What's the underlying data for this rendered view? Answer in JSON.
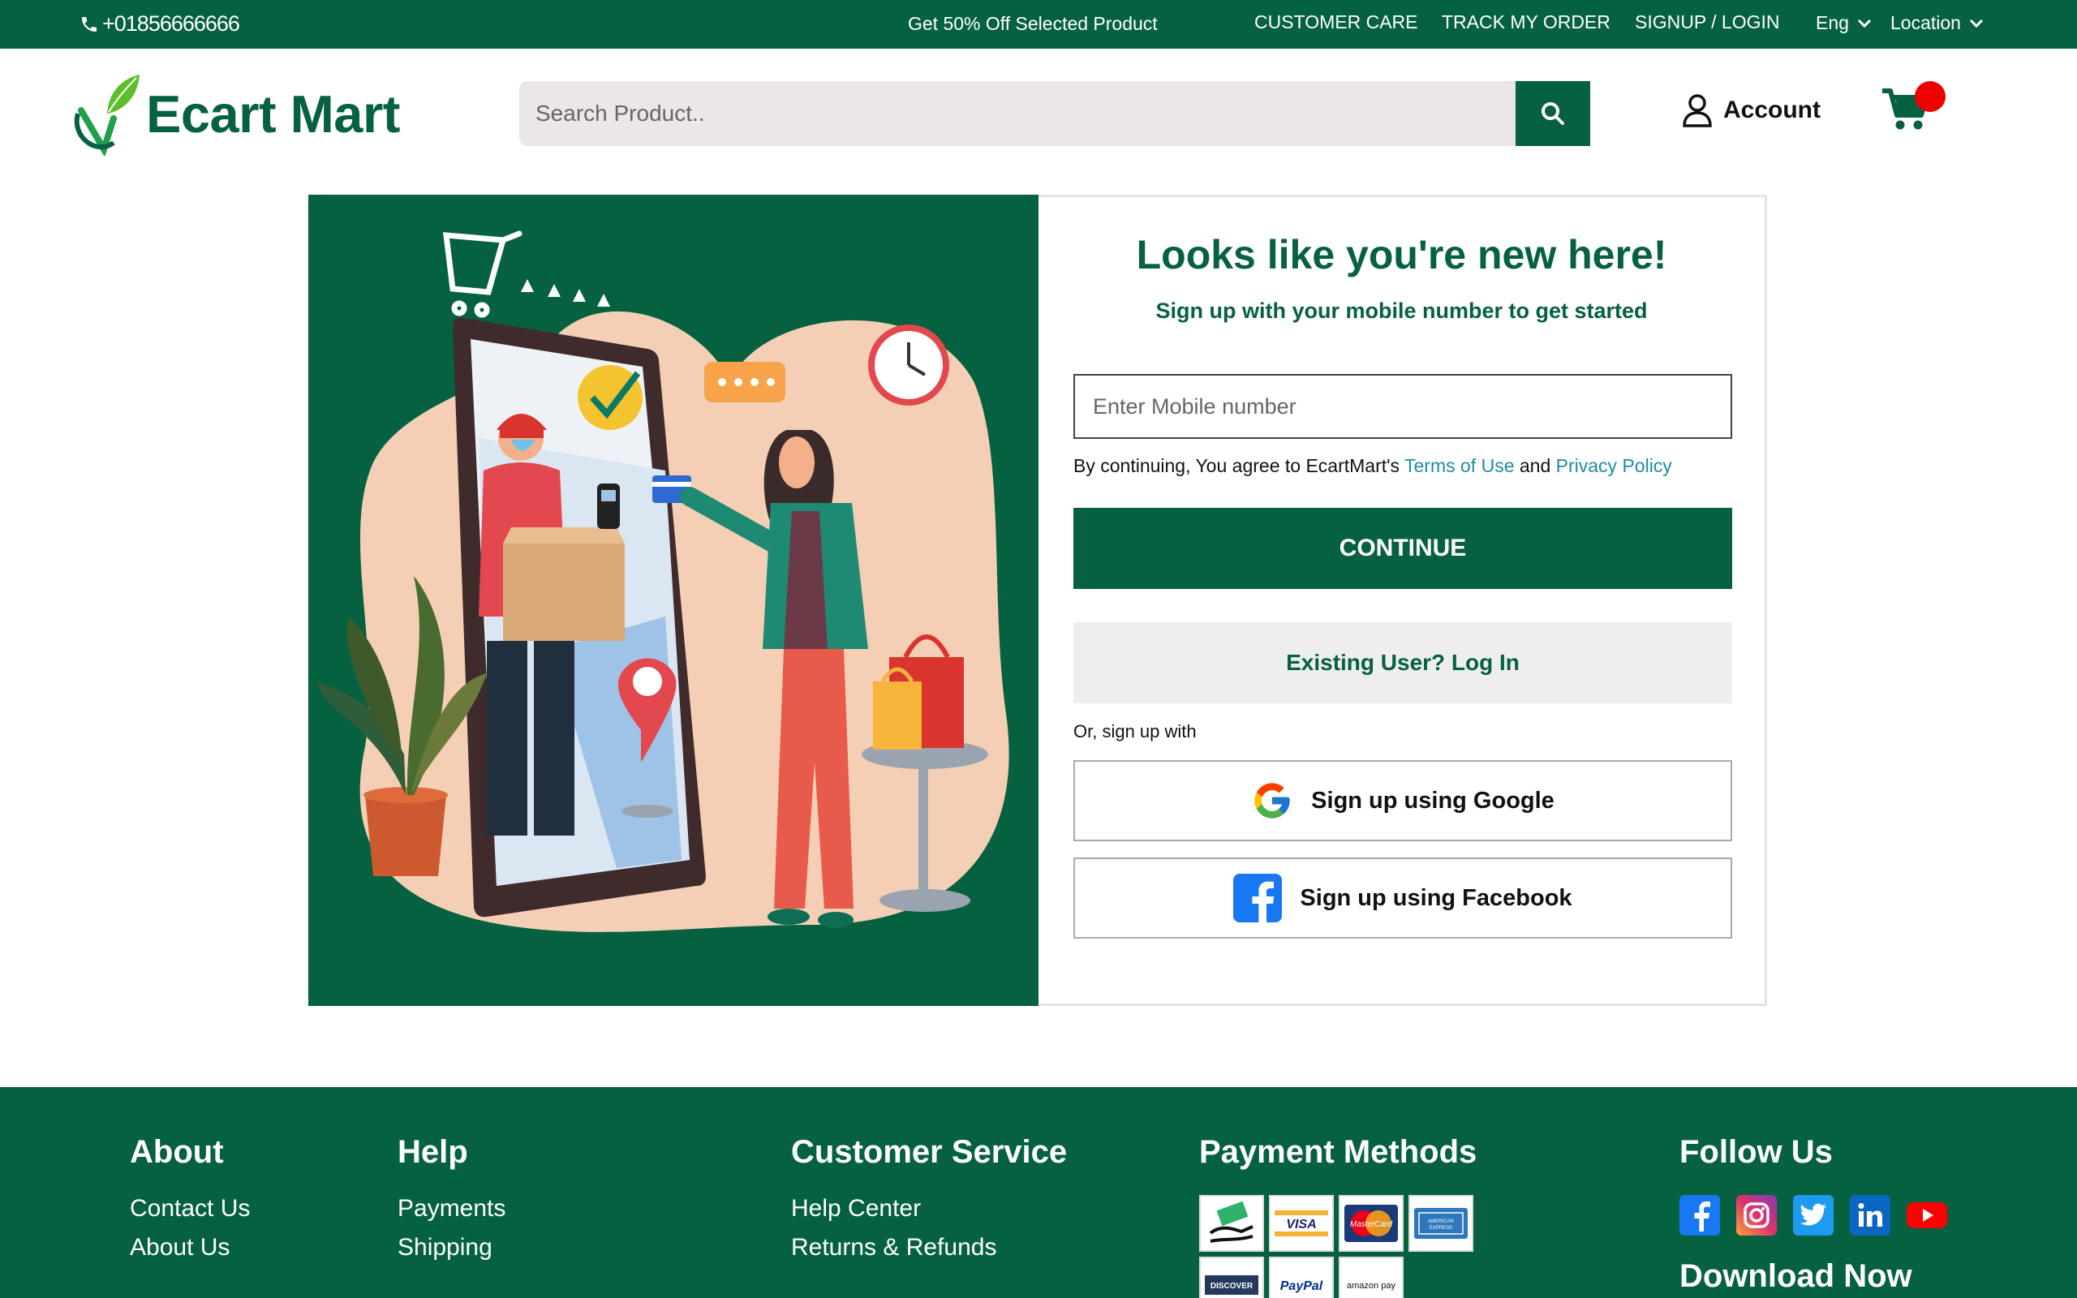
{
  "topbar": {
    "phone": "+01856666666",
    "promo": "Get 50% Off Selected Product",
    "links": [
      "CUSTOMER CARE",
      "TRACK MY ORDER",
      "SIGNUP / LOGIN"
    ],
    "language": "Eng",
    "location": "Location"
  },
  "header": {
    "brand": "Ecart Mart",
    "search_placeholder": "Search Product..",
    "account_label": "Account"
  },
  "signup": {
    "title": "Looks like you're new here!",
    "subtitle": "Sign up with your mobile number to get started",
    "mobile_placeholder": "Enter Mobile number",
    "terms_prefix": "By continuing, You agree to EcartMart's",
    "terms_link": "Terms of Use",
    "terms_and": "and",
    "privacy_link": "Privacy Policy",
    "continue_label": "CONTINUE",
    "login_label": "Existing User? Log In",
    "or_label": "Or, sign up with",
    "google_label": "Sign up using Google",
    "facebook_label": "Sign up using Facebook"
  },
  "footer": {
    "about": {
      "title": "About",
      "links": [
        "Contact Us",
        "About Us"
      ]
    },
    "help": {
      "title": "Help",
      "links": [
        "Payments",
        "Shipping"
      ]
    },
    "customer_service": {
      "title": "Customer Service",
      "links": [
        "Help Center",
        "Returns & Refunds"
      ]
    },
    "payment": {
      "title": "Payment Methods",
      "methods": [
        "cash-on-delivery-icon",
        "VISA",
        "MasterCard",
        "American Express",
        "DISCOVER",
        "PayPal",
        "amazon pay"
      ]
    },
    "follow": {
      "title": "Follow Us",
      "networks": [
        "facebook-icon",
        "instagram-icon",
        "twitter-icon",
        "linkedin-icon",
        "youtube-icon"
      ]
    },
    "download": "Download Now"
  },
  "colors": {
    "brand_green": "#05613f",
    "accent_red": "#ee0000",
    "link_blue": "#1f8ca3"
  }
}
